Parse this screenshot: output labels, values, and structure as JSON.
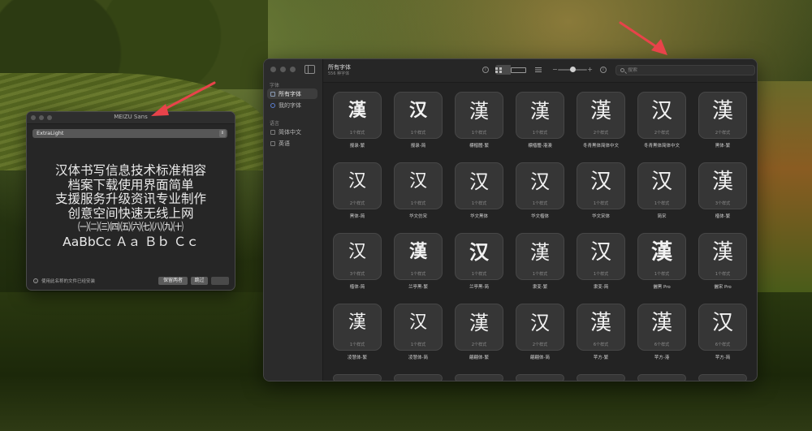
{
  "font_book": {
    "toolbar": {
      "title": "所有字体",
      "subtitle": "556 种字体",
      "search_placeholder": "搜索",
      "slider_minus": "−",
      "slider_plus": "+",
      "info_glyph": "i"
    },
    "sidebar": {
      "sections": [
        {
          "header": "字体",
          "items": [
            {
              "label": "所有字体",
              "active": true,
              "icon": "font-collection-icon"
            },
            {
              "label": "我的字体",
              "active": false,
              "icon": "user-fonts-icon"
            }
          ]
        },
        {
          "header": "语言",
          "items": [
            {
              "label": "简体中文",
              "active": false,
              "icon": "language-icon"
            },
            {
              "label": "英语",
              "active": false,
              "icon": "language-icon"
            }
          ]
        }
      ]
    },
    "fonts": [
      {
        "glyph": "漢",
        "styles": "1个样式",
        "name": "报录-繁"
      },
      {
        "glyph": "汉",
        "styles": "1个样式",
        "name": "报录-简"
      },
      {
        "glyph": "漢",
        "styles": "1个样式",
        "name": "標楷體-繁"
      },
      {
        "glyph": "漢",
        "styles": "1个样式",
        "name": "標楷體-港澳"
      },
      {
        "glyph": "漢",
        "styles": "2个样式",
        "name": "冬青黑体简体中文"
      },
      {
        "glyph": "汉",
        "styles": "2个样式",
        "name": "冬青黑体简体中文"
      },
      {
        "glyph": "漢",
        "styles": "2个样式",
        "name": "黑体-繁"
      },
      {
        "glyph": "汉",
        "styles": "2个样式",
        "name": "黑体-简"
      },
      {
        "glyph": "汉",
        "styles": "1个样式",
        "name": "华文仿宋"
      },
      {
        "glyph": "汉",
        "styles": "1个样式",
        "name": "华文黑体"
      },
      {
        "glyph": "汉",
        "styles": "1个样式",
        "name": "华文楷体"
      },
      {
        "glyph": "汉",
        "styles": "1个样式",
        "name": "华文宋体"
      },
      {
        "glyph": "汉",
        "styles": "1个样式",
        "name": "简宋"
      },
      {
        "glyph": "漢",
        "styles": "3个样式",
        "name": "楷体-繁"
      },
      {
        "glyph": "汉",
        "styles": "3个样式",
        "name": "楷体-简"
      },
      {
        "glyph": "漢",
        "styles": "1个样式",
        "name": "兰亭黑-繁"
      },
      {
        "glyph": "汉",
        "styles": "1个样式",
        "name": "兰亭黑-简"
      },
      {
        "glyph": "漢",
        "styles": "1个样式",
        "name": "隶变-繁"
      },
      {
        "glyph": "汉",
        "styles": "1个样式",
        "name": "隶变-简"
      },
      {
        "glyph": "漢",
        "styles": "1个样式",
        "name": "儷黑 Pro"
      },
      {
        "glyph": "漢",
        "styles": "1个样式",
        "name": "儷宋 Pro"
      },
      {
        "glyph": "漢",
        "styles": "1个样式",
        "name": "凌慧体-繁"
      },
      {
        "glyph": "汉",
        "styles": "1个样式",
        "name": "凌慧体-简"
      },
      {
        "glyph": "漢",
        "styles": "2个样式",
        "name": "翩翩体-繁"
      },
      {
        "glyph": "汉",
        "styles": "2个样式",
        "name": "翩翩体-简"
      },
      {
        "glyph": "漢",
        "styles": "6个样式",
        "name": "苹方-繁"
      },
      {
        "glyph": "漢",
        "styles": "6个样式",
        "name": "苹方-港"
      },
      {
        "glyph": "汉",
        "styles": "6个样式",
        "name": "苹方-简"
      }
    ]
  },
  "install_dialog": {
    "title": "MEIZU Sans",
    "style_selected": "ExtraLight",
    "sample_lines": [
      "汉体书写信息技术标准相容",
      "档案下载使用界面简单",
      "支援服务升级资讯专业制作",
      "创意空间快速无线上网",
      "㈠㈡㈢㈣㈤㈥㈦㈧㈨㈩",
      "AaBbCc Ａａ Ｂｂ Ｃｃ"
    ],
    "footer_message": "使用此名称的文件已经安装",
    "keep_both_label": "保留两者",
    "skip_label": "跳过"
  },
  "annotations": {
    "arrow_color": "#e8434a"
  }
}
